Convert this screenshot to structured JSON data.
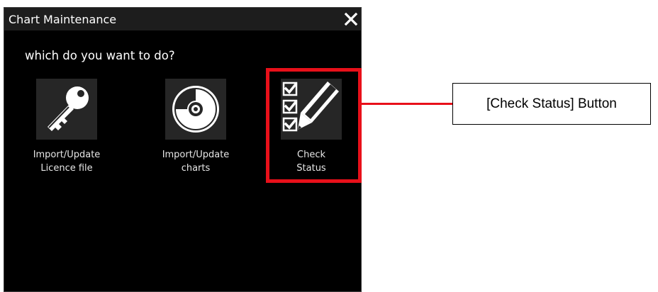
{
  "dialog": {
    "title": "Chart Maintenance",
    "prompt": "which do you want to do?"
  },
  "actions": [
    {
      "icon": "key-icon",
      "label_line1": "Import/Update",
      "label_line2": "Licence file"
    },
    {
      "icon": "disc-icon",
      "label_line1": "Import/Update",
      "label_line2": "charts"
    },
    {
      "icon": "checklist-pencil-icon",
      "label_line1": "Check",
      "label_line2": "Status"
    }
  ],
  "annotation": {
    "callout_text": "[Check Status] Button",
    "highlight_color": "#e8101a"
  },
  "colors": {
    "dialog_background": "#000000",
    "titlebar_background": "#1d1d1d",
    "tile_background": "#262626",
    "text": "#ffffff"
  }
}
